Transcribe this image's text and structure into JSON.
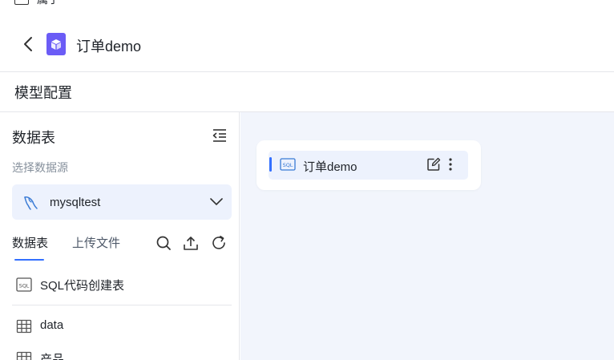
{
  "top_partial": {
    "label": "属子"
  },
  "header": {
    "title": "订单demo"
  },
  "section": {
    "title": "模型配置"
  },
  "left_panel": {
    "title": "数据表",
    "datasource_label": "选择数据源",
    "datasource_value": "mysqltest",
    "tabs": [
      {
        "label": "数据表",
        "active": true
      },
      {
        "label": "上传文件",
        "active": false
      }
    ],
    "items": [
      {
        "label": "SQL代码创建表",
        "icon": "sql-icon"
      },
      {
        "label": "data",
        "icon": "table-icon"
      },
      {
        "label": "产品",
        "icon": "table-icon"
      }
    ]
  },
  "canvas": {
    "node": {
      "label": "订单demo",
      "icon": "sql-icon"
    }
  },
  "colors": {
    "accent": "#3370ff",
    "app_icon": "#6b5cf6",
    "select_bg": "#edf2fd",
    "canvas_bg": "#f2f5fc"
  }
}
